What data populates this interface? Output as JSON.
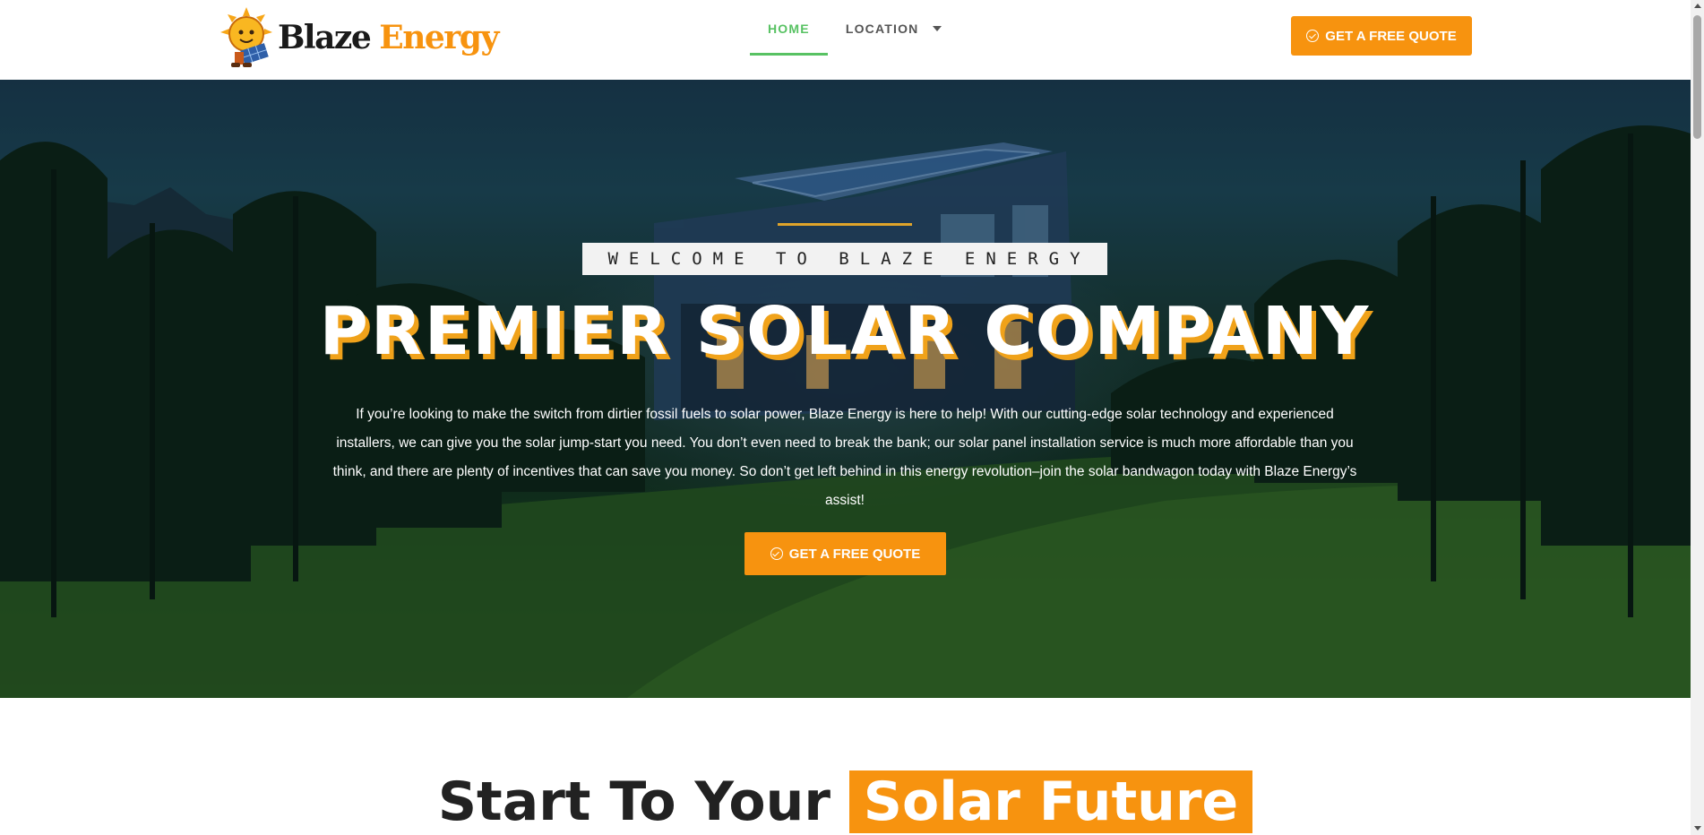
{
  "header": {
    "logo": {
      "word1": "Blaze",
      "word2": "Energy"
    },
    "nav": [
      {
        "label": "HOME",
        "active": true
      },
      {
        "label": "LOCATION",
        "has_dropdown": true
      }
    ],
    "cta_label": "GET A FREE QUOTE"
  },
  "hero": {
    "eyebrow": "WELCOME TO BLAZE ENERGY",
    "title": "PREMIER SOLAR COMPANY",
    "text": "If you’re looking to make the switch from dirtier fossil fuels to solar power, Blaze Energy is here to help! With our cutting-edge solar technology and experienced installers, we can give you the solar jump-start you need. You don’t even need to break the bank; our solar panel installation service is much more affordable than you think, and there are plenty of incentives that can save you money. So don’t get left behind in this energy revolution–join the solar bandwagon today with Blaze Energy’s assist!",
    "cta_label": "GET A FREE QUOTE"
  },
  "section": {
    "heading_part1": "Start To Your",
    "heading_highlight": "Solar Future"
  },
  "colors": {
    "accent": "#f7930f",
    "nav_active": "#58c263",
    "title_shadow": "#f0a21a"
  },
  "icons": [
    "check-circle-icon",
    "chevron-down-icon",
    "sun-mascot-logo"
  ]
}
